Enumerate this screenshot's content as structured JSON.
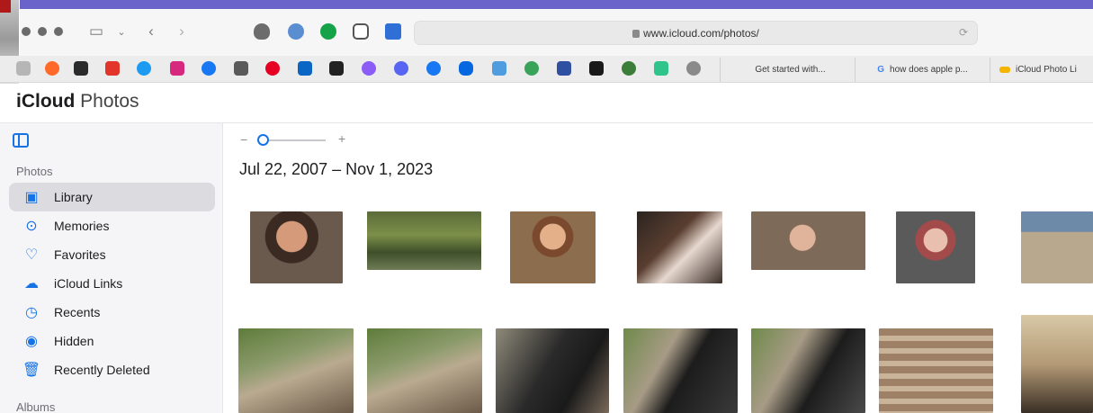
{
  "browser": {
    "url": "www.icloud.com/photos/",
    "tabs": [
      {
        "icon": "",
        "title": "Get started with..."
      },
      {
        "icon": "G",
        "title": "how does apple p..."
      },
      {
        "icon": "",
        "title": "iCloud Photo Li"
      }
    ]
  },
  "app": {
    "brand_bold": "iCloud",
    "brand_rest": " Photos"
  },
  "sidebar": {
    "section_photos": "Photos",
    "items": [
      {
        "label": "Library",
        "icon": "library-icon"
      },
      {
        "label": "Memories",
        "icon": "memories-icon"
      },
      {
        "label": "Favorites",
        "icon": "heart-icon"
      },
      {
        "label": "iCloud Links",
        "icon": "cloud-link-icon"
      },
      {
        "label": "Recents",
        "icon": "clock-icon"
      },
      {
        "label": "Hidden",
        "icon": "eye-slash-icon"
      },
      {
        "label": "Recently Deleted",
        "icon": "trash-icon"
      }
    ],
    "section_albums": "Albums"
  },
  "main": {
    "zoom_minus": "−",
    "zoom_plus": "+",
    "date_range": "Jul 22, 2007 – Nov 1, 2023"
  },
  "colors": {
    "accent": "#1673e6",
    "selected_bg": "#dcdce0",
    "sidebar_bg": "#f5f5f7"
  }
}
